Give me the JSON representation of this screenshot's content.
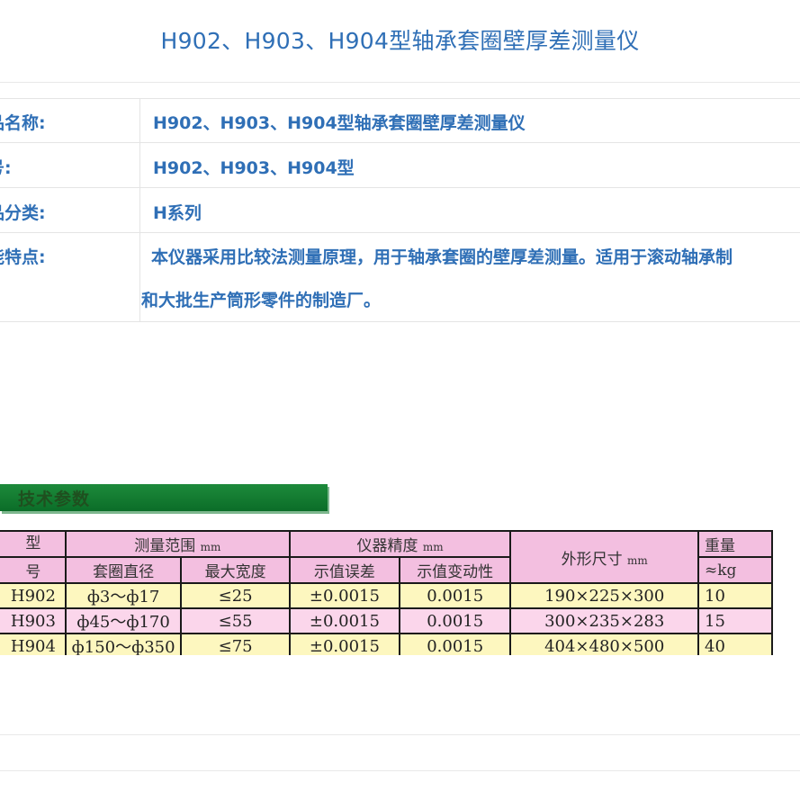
{
  "page": {
    "title": "H902、H903、H904型轴承套圈壁厚差测量仪"
  },
  "info_rows": [
    {
      "label": "品名称:",
      "value": "H902、H903、H904型轴承套圈壁厚差测量仪"
    },
    {
      "label": "号:",
      "value": "H902、H903、H904型"
    },
    {
      "label": "品分类:",
      "value": "H系列"
    },
    {
      "label": "能特点:",
      "value_line1": "本仪器采用比较法测量原理，用于轴承套圈的壁厚差测量。适用于滚动轴承制",
      "value_line2": "和大批生产筒形零件的制造厂。"
    }
  ],
  "spec": {
    "banner": "技术参数",
    "headers": {
      "model_top": "型",
      "model_bottom": "号",
      "range": "测量范围",
      "range_unit": "mm",
      "range_sub1": "套圈直径",
      "range_sub2": "最大宽度",
      "accuracy": "仪器精度",
      "accuracy_unit": "mm",
      "acc_sub1": "示值误差",
      "acc_sub2": "示值变动性",
      "size": "外形尺寸",
      "size_unit": "mm",
      "weight": "重量",
      "weight_unit": "≈kg"
    },
    "rows": [
      {
        "model": "H902",
        "dia": "ф3～ф17",
        "width": "≤25",
        "err": "±0.0015",
        "var": "0.0015",
        "size": "190×225×300",
        "weight": "10"
      },
      {
        "model": "H903",
        "dia": "ф45～ф170",
        "width": "≤55",
        "err": "±0.0015",
        "var": "0.0015",
        "size": "300×235×283",
        "weight": "15"
      },
      {
        "model": "H904",
        "dia": "ф150～ф350",
        "width": "≤75",
        "err": "±0.0015",
        "var": "0.0015",
        "size": "404×480×500",
        "weight": "40"
      }
    ]
  }
}
